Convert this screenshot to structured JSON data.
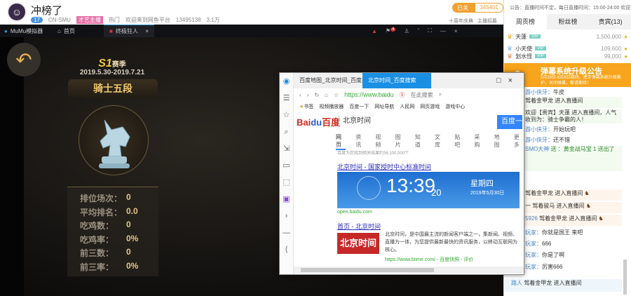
{
  "stream": {
    "title": "冲榜了",
    "level": "17",
    "category": "CN-SMU",
    "tag": "才艺主播",
    "meta": [
      "热门",
      "欢迎来到网鱼平台",
      "13495138",
      "3.1万"
    ],
    "follow_label": "已关注",
    "follow_count": "345401",
    "links": [
      "十周年庆典",
      "主播招募"
    ]
  },
  "emulator": {
    "app": "MuMu模拟器",
    "home": "首页",
    "game_tab": "终极狂人",
    "badge": "4"
  },
  "game": {
    "season": "S1",
    "season_suffix": "赛季",
    "dates": "2019.5.30-2019.7.21",
    "rank": "骑士五段",
    "stats": [
      {
        "label": "排位场次：",
        "value": "0"
      },
      {
        "label": "平均排名：",
        "value": "0.0"
      },
      {
        "label": "吃鸡数：",
        "value": "0"
      },
      {
        "label": "吃鸡率：",
        "value": "0%"
      },
      {
        "label": "前三数：",
        "value": "0"
      },
      {
        "label": "前三率：",
        "value": "0%"
      }
    ]
  },
  "browser": {
    "tabs": [
      "百度地图_北京时间_百度搜索",
      "北京时间_百度搜索"
    ],
    "url": "https://www.baidu",
    "search_shortcut": "在此搜索",
    "bookmarks": [
      "书签",
      "视频播放器",
      "百度一下",
      "网址导航",
      "人民网",
      "网页游戏",
      "游戏中心"
    ],
    "logo_en": "Bai",
    "logo_du": "du",
    "logo_cn": "百度",
    "query": "北京时间",
    "search_button": "百度一下",
    "nav": [
      "网页",
      "资讯",
      "视频",
      "图片",
      "知道",
      "文库",
      "贴吧",
      "采购",
      "地图",
      "更多"
    ],
    "result_count": "百度为您找到相关结果约36,100,000个",
    "result1_title": "北京时间 - 国家授时中心标准时间",
    "clock_time": "13:39",
    "clock_seconds": "20",
    "clock_weekday": "星期四",
    "clock_date": "2019年5月30日",
    "result1_src": "open.baidu.com",
    "result2_title": "首页 - 北京时间",
    "result2_logo": "北京时间",
    "result2_desc": "北京时间，是中国最主流的新闻客户端之一，集新闻、视频、直播为一体，为您提供最新最快的资讯服务，以移动互联网为核心。",
    "result2_src": "https://www.btime.com/ - 百度快照 - 评价"
  },
  "sidebar": {
    "notice": "公告：直播时间不定，每日直播时间：15:00-24:00 欢迎...",
    "tabs": [
      "周贡榜",
      "粉丝榜",
      "贵宾(13)"
    ],
    "ranking": [
      {
        "name": "天蓬",
        "amount": "1,500,000"
      },
      {
        "name": "小天使",
        "amount": "109,600"
      },
      {
        "name": "划水怪",
        "amount": "99,000"
      }
    ],
    "banner_title": "弹幕系统升级公告",
    "banner_desc": "5月29日-6月6日期间，虎牙弹幕系统升级维护，关闭弹幕，敬请期待！",
    "chat": [
      {
        "user": "游小侠牙：",
        "text": "牛皮"
      },
      {
        "user": "",
        "text": "驾着金甲龙 进入直播间"
      },
      {
        "user": "",
        "text": "欢迎【贵宾】天蓬 进入直播间，人气收到为：骑士争霸的人！"
      },
      {
        "user": "游小侠牙：",
        "text": "开始玩吧"
      },
      {
        "user": "游小侠牙：",
        "text": "还不错"
      },
      {
        "user": "SMO大神",
        "text": "送 ：黄金战马宝 1 送出了"
      },
      {
        "user": "",
        "text": "驾着金甲龙 进入直播间"
      },
      {
        "user": "一",
        "text": "驾着骏马 进入直播间"
      },
      {
        "user": "5926",
        "text": "驾着金甲龙 进入直播间"
      },
      {
        "user": "玩家：",
        "text": "你就是国王 来吧"
      },
      {
        "user": "玩家：",
        "text": "666"
      },
      {
        "user": "玩家：",
        "text": "你是了啊"
      },
      {
        "user": "玩家：",
        "text": "厉害666"
      },
      {
        "user": "路人",
        "text": "驾着金甲龙 进入直播间"
      }
    ]
  }
}
